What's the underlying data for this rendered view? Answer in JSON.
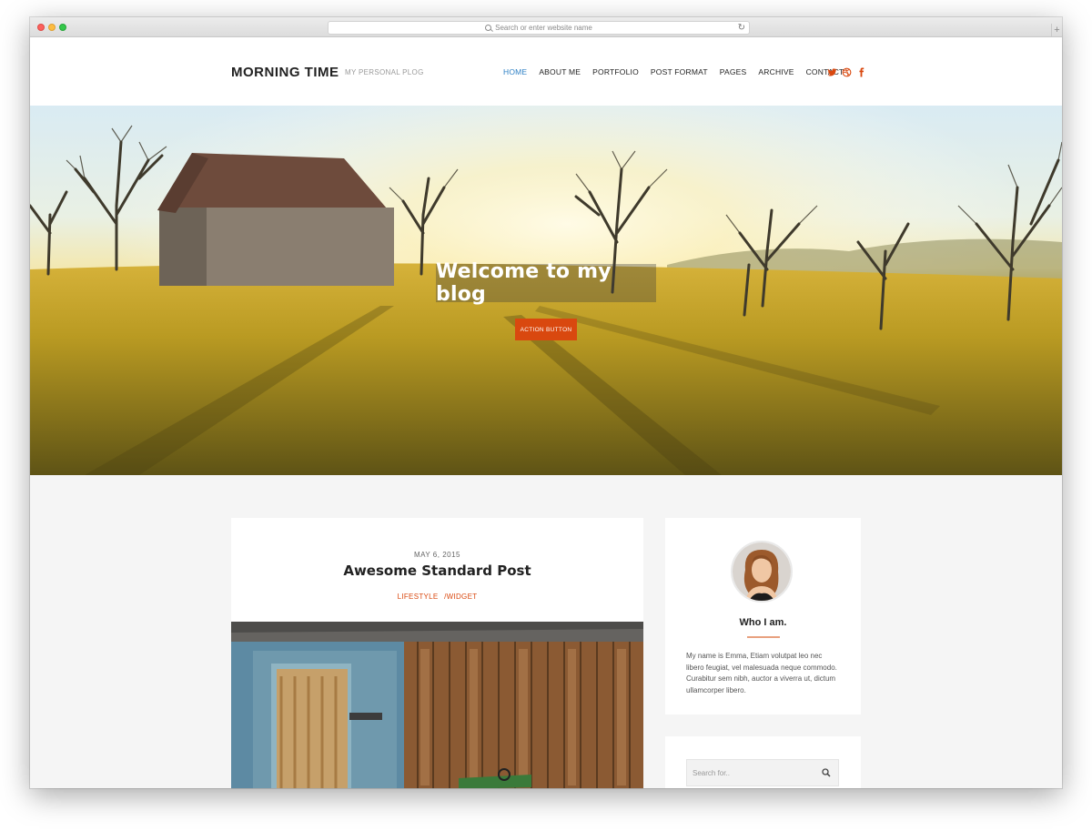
{
  "browser": {
    "address_placeholder": "Search or enter website name",
    "reload_icon": "reload-icon",
    "new_tab_symbol": "+"
  },
  "header": {
    "logo": "MORNING TIME",
    "tagline": "MY PERSONAL PLOG",
    "nav": [
      {
        "label": "HOME",
        "active": true
      },
      {
        "label": "ABOUT ME",
        "active": false
      },
      {
        "label": "PORTFOLIO",
        "active": false
      },
      {
        "label": "POST FORMAT",
        "active": false
      },
      {
        "label": "PAGES",
        "active": false
      },
      {
        "label": "ARCHIVE",
        "active": false
      },
      {
        "label": "CONTACT",
        "active": false
      }
    ],
    "social_icons": [
      "twitter-icon",
      "dribbble-icon",
      "facebook-icon"
    ],
    "accent_color": "#d9480f",
    "active_color": "#2e80c5"
  },
  "hero": {
    "title": "Welcome to my blog",
    "button_label": "ACTION BUTTON"
  },
  "post": {
    "date": "MAY 6, 2015",
    "title": "Awesome Standard Post",
    "categories": [
      "LIFESTYLE",
      "/WIDGET"
    ]
  },
  "about": {
    "title": "Who I am.",
    "text": "My name is Emma, Etiam volutpat leo nec libero feugiat, vel malesuada neque commodo. Curabitur sem nibh, auctor a viverra ut, dictum ullamcorper libero."
  },
  "search": {
    "placeholder": "Search for.."
  }
}
